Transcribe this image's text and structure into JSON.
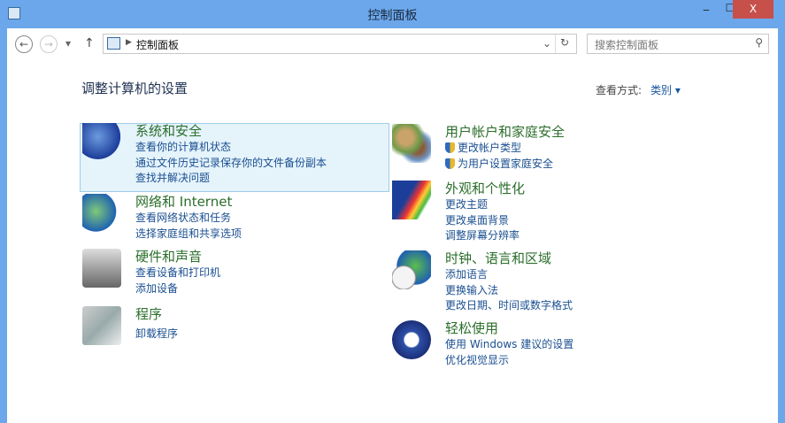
{
  "window": {
    "title": "控制面板",
    "minimize": "‒",
    "maximize": "☐",
    "close": "X"
  },
  "nav": {
    "back": "←",
    "forward": "→",
    "recent": "▾",
    "up": "↑",
    "breadcrumb": "控制面板",
    "search_placeholder": "搜索控制面板"
  },
  "header": {
    "title": "调整计算机的设置",
    "view_by_label": "查看方式:",
    "view_by_value": "类别"
  },
  "categories": [
    {
      "title": "系统和安全",
      "links": [
        "查看你的计算机状态",
        "通过文件历史记录保存你的文件备份副本",
        "查找并解决问题"
      ]
    },
    {
      "title": "网络和 Internet",
      "links": [
        "查看网络状态和任务",
        "选择家庭组和共享选项"
      ]
    },
    {
      "title": "硬件和声音",
      "links": [
        "查看设备和打印机",
        "添加设备"
      ]
    },
    {
      "title": "程序",
      "links": [
        "卸载程序"
      ]
    },
    {
      "title": "用户帐户和家庭安全",
      "links": [
        "更改帐户类型",
        "为用户设置家庭安全"
      ]
    },
    {
      "title": "外观和个性化",
      "links": [
        "更改主题",
        "更改桌面背景",
        "调整屏幕分辨率"
      ]
    },
    {
      "title": "时钟、语言和区域",
      "links": [
        "添加语言",
        "更换输入法",
        "更改日期、时间或数字格式"
      ]
    },
    {
      "title": "轻松使用",
      "links": [
        "使用 Windows 建议的设置",
        "优化视觉显示"
      ]
    }
  ]
}
